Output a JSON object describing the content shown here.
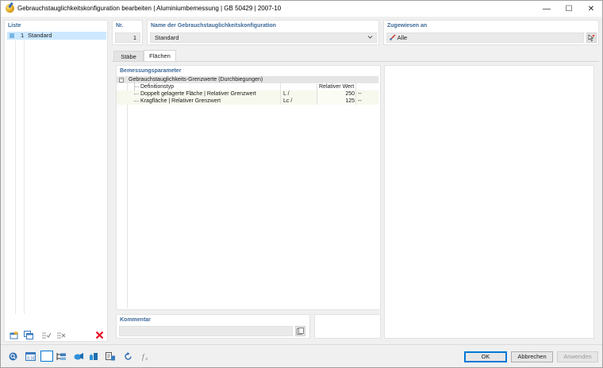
{
  "window": {
    "title": "Gebrauchstauglichkeitskonfiguration bearbeiten | Aluminiumbemessung | GB 50429 | 2007-10",
    "minimize": "—",
    "maximize": "☐",
    "close": "✕"
  },
  "list": {
    "heading": "Liste",
    "items": [
      {
        "number": "1",
        "label": "Standard"
      }
    ]
  },
  "nr": {
    "heading": "Nr.",
    "value": "1"
  },
  "config_name": {
    "heading": "Name der Gebrauchstauglichkeitskonfiguration",
    "value": "Standard"
  },
  "assigned": {
    "heading": "Zugewiesen an",
    "value": "Alle"
  },
  "tabs": [
    {
      "label": "Stäbe"
    },
    {
      "label": "Flächen"
    }
  ],
  "params": {
    "heading": "Bemessungsparameter",
    "group_label": "Gebrauchstauglichkeits-Grenzwerte (Durchbiegungen)",
    "collapse_symbol": "−",
    "rows": [
      {
        "label": "Definitionstyp",
        "symbol": "",
        "value": "Relativer Wert",
        "unit": ""
      },
      {
        "label": "Doppelt gelagerte Fläche | Relativer Grenzwert",
        "symbol": "L /",
        "value": "250",
        "unit": "--"
      },
      {
        "label": "Kragfläche | Relativer Grenzwert",
        "symbol": "Lc /",
        "value": "125",
        "unit": "--"
      }
    ]
  },
  "comment": {
    "heading": "Kommentar",
    "value": ""
  },
  "buttons": {
    "ok": "OK",
    "cancel": "Abbrechen",
    "apply": "Anwenden"
  },
  "colors": {
    "accent": "#3d6a99",
    "selection": "#cce8ff",
    "delete": "#e81123"
  }
}
